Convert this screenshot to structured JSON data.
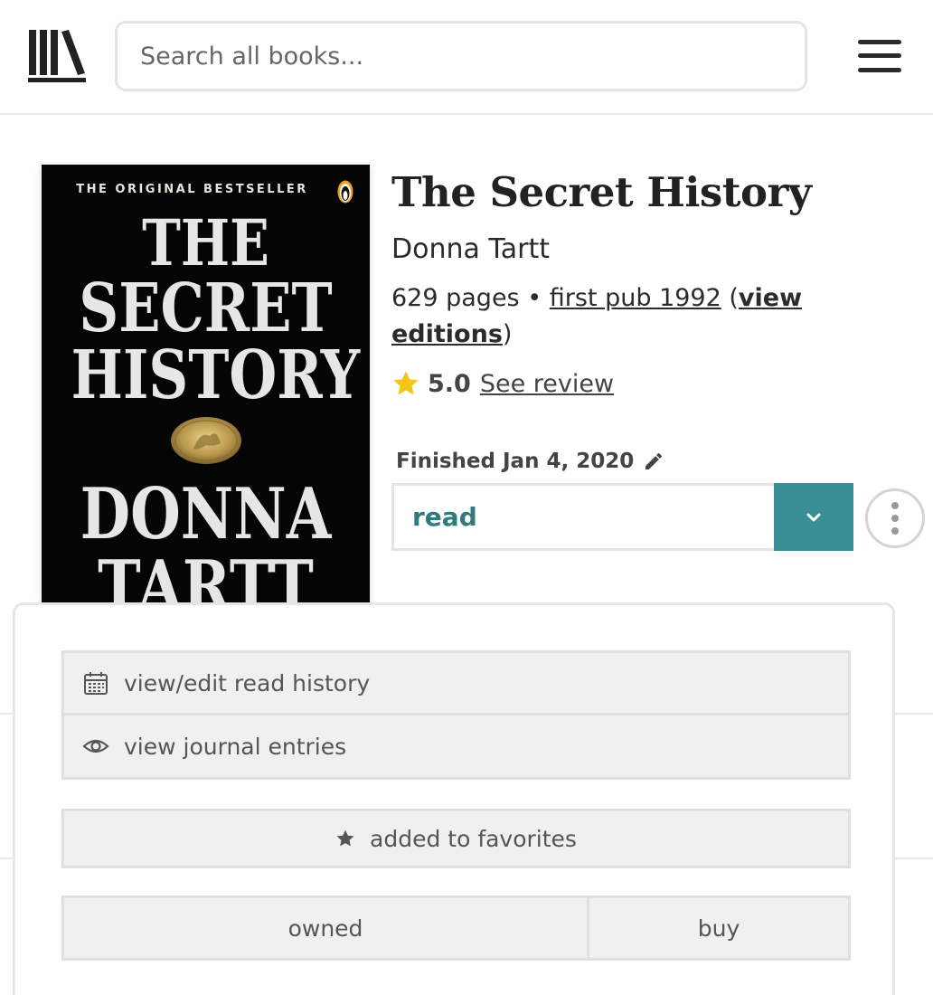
{
  "header": {
    "logo": "library-books-icon",
    "search_placeholder": "Search all books...",
    "menu_icon": "hamburger-menu-icon"
  },
  "book": {
    "cover": {
      "tagline": "THE ORIGINAL BESTSELLER",
      "title_lines": [
        "THE",
        "SECRET",
        "HISTORY"
      ],
      "author_lines": [
        "DONNA",
        "TARTT"
      ],
      "publisher_icon": "penguin-icon"
    },
    "title": "The Secret History",
    "author": "Donna Tartt",
    "pages": "629 pages",
    "separator": "•",
    "first_pub": "first pub 1992",
    "open_paren": "(",
    "view_editions": "view editions",
    "close_paren": ")",
    "rating": "5.0",
    "see_review": "See review"
  },
  "reading": {
    "finished_label": "Finished Jan 4, 2020",
    "status": "read",
    "colors": {
      "teal": "#3a8e95",
      "teal_text": "#2e7a7e",
      "star": "#f5c518"
    }
  },
  "popup": {
    "read_history": "view/edit read history",
    "journal": "view journal entries",
    "favorites": "added to favorites",
    "owned": "owned",
    "buy": "buy"
  }
}
